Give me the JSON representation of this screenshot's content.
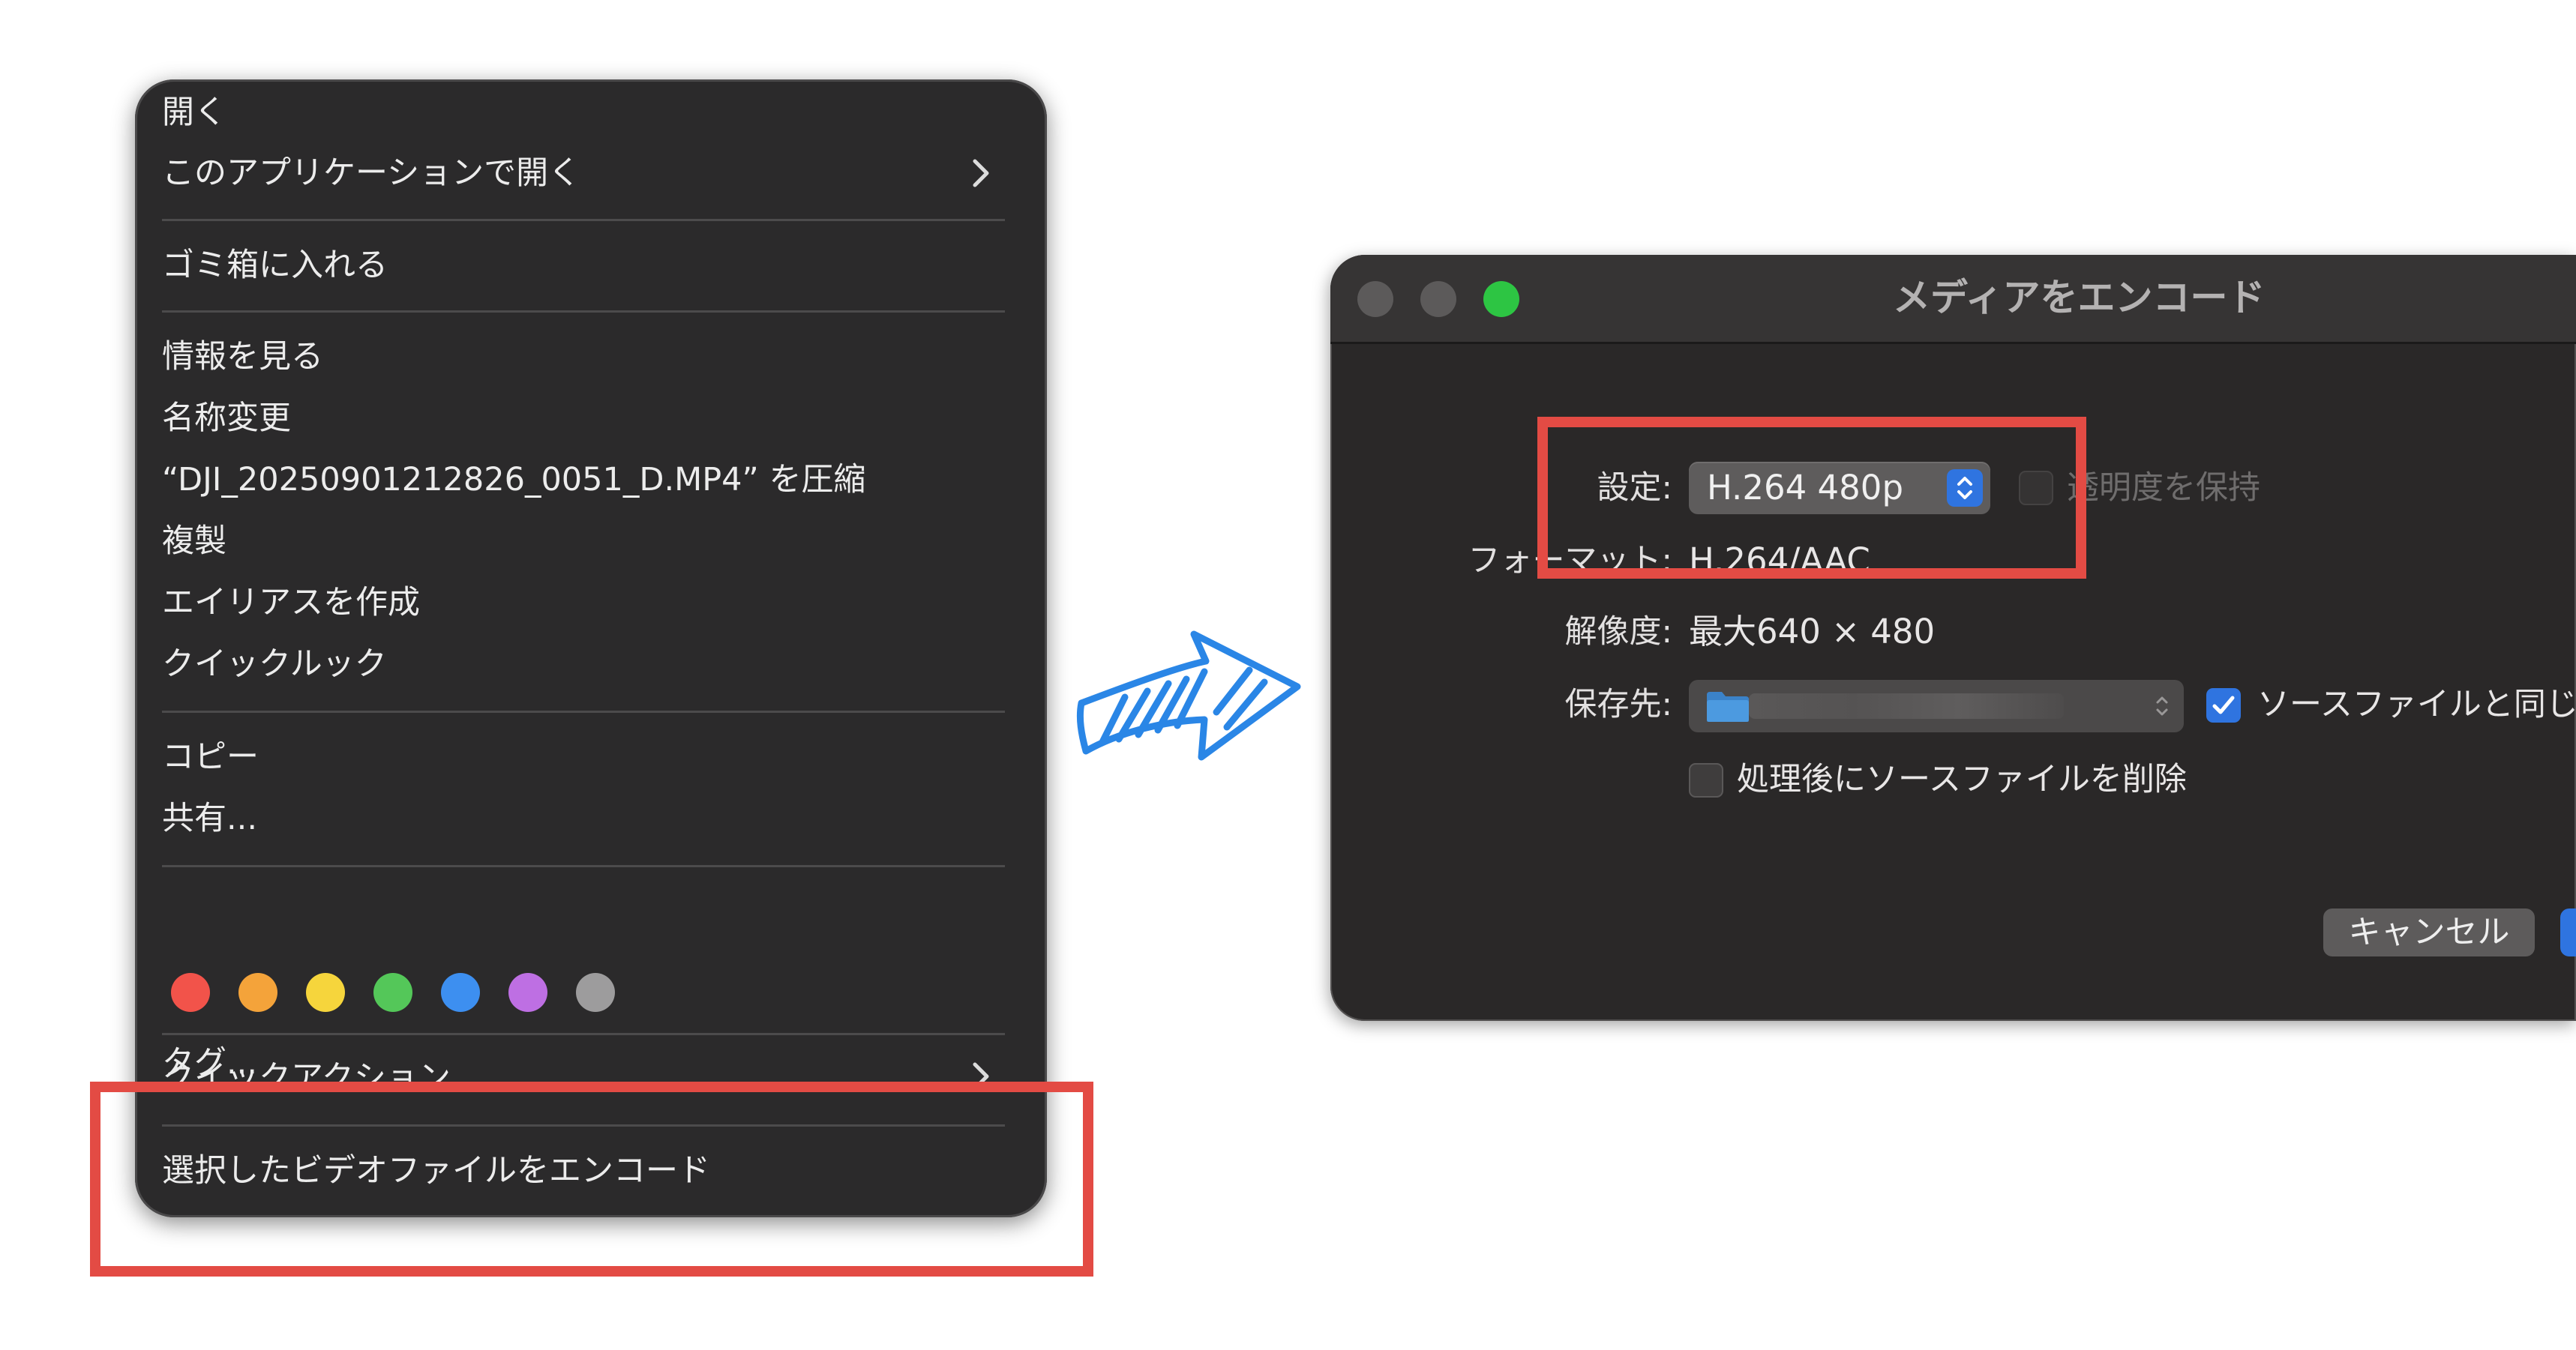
{
  "context_menu": {
    "open": "開く",
    "open_with": "このアプリケーションで開く",
    "move_to_trash": "ゴミ箱に入れる",
    "get_info": "情報を見る",
    "rename": "名称変更",
    "compress": "“DJI_20250901212826_0051_D.MP4” を圧縮",
    "duplicate": "複製",
    "make_alias": "エイリアスを作成",
    "quick_look": "クイックルック",
    "copy": "コピー",
    "share": "共有...",
    "tags": "タグ...",
    "quick_actions": "クイックアクション",
    "encode_selected": "選択したビデオファイルをエンコード",
    "tag_colors": [
      "#f2534a",
      "#f4a33a",
      "#f6d53c",
      "#54c759",
      "#3d8ff0",
      "#be6fe3",
      "#9d9c9d"
    ]
  },
  "dialog": {
    "title": "メディアをエンコード",
    "setting_label": "設定:",
    "setting_value": "H.264 480p",
    "preserve_transparency": "透明度を保持",
    "format_label": "フォーマット:",
    "format_value": "H.264/AAC",
    "resolution_label": "解像度:",
    "resolution_value": "最大640 × 480",
    "destination_label": "保存先:",
    "same_as_source": "ソースファイルと同じ",
    "delete_after": "処理後にソースファイルを削除",
    "cancel": "キャンセル",
    "traffic_lights": [
      "#5c5a5a",
      "#5c5a5a",
      "#2dc543"
    ]
  },
  "colors": {
    "highlight": "#e34b44",
    "accent_blue": "#2f74e0",
    "arrow": "#2a86e6"
  }
}
